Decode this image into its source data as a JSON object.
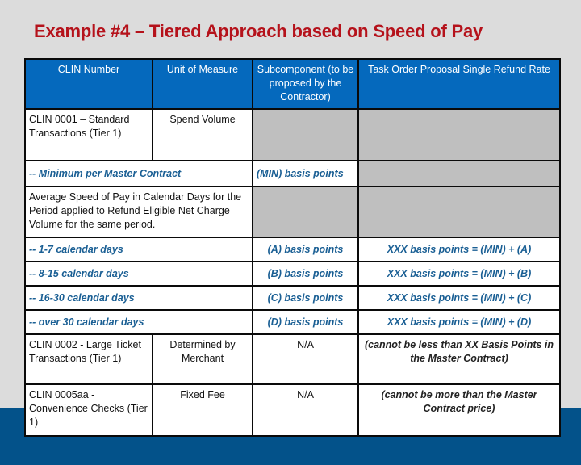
{
  "title": "Example #4 – Tiered Approach based on Speed of Pay",
  "colors": {
    "title": "#b5121b",
    "header_bg": "#0569bd",
    "gray_cell": "#bfbfbf",
    "italic_blue": "#1a5f94",
    "bottom_band": "#03528a",
    "background": "#dcdcdc"
  },
  "table": {
    "headers": [
      "CLIN Number",
      "Unit of Measure",
      "Subcomponent (to be proposed by the Contractor)",
      "Task Order Proposal Single Refund Rate"
    ],
    "clin_0001": {
      "clin": "CLIN 0001 – Standard Transactions (Tier 1)",
      "unit": "Spend Volume"
    },
    "minimum": {
      "label": "-- Minimum per Master Contract",
      "subcomponent": "(MIN) basis points"
    },
    "speed_note": "Average Speed of Pay in Calendar Days for the Period applied to Refund Eligible Net Charge Volume for the same period.",
    "tiers": [
      {
        "label": "-- 1-7 calendar days",
        "subcomponent": "(A) basis points",
        "rate": "XXX basis points  = (MIN) + (A)"
      },
      {
        "label": "-- 8-15 calendar days",
        "subcomponent": "(B) basis points",
        "rate": "XXX basis points = (MIN) + (B)"
      },
      {
        "label": "-- 16-30 calendar days",
        "subcomponent": "(C) basis points",
        "rate": "XXX basis points = (MIN) + (C)"
      },
      {
        "label": "-- over 30 calendar days",
        "subcomponent": "(D) basis points",
        "rate": "XXX basis points = (MIN) + (D)"
      }
    ],
    "clin_0002": {
      "clin": "CLIN 0002 - Large Ticket Transactions (Tier 1)",
      "unit": "Determined by Merchant",
      "subcomponent": "N/A",
      "rate": "(cannot be less than XX Basis Points in the Master Contract)"
    },
    "clin_0005aa": {
      "clin": "CLIN 0005aa - Convenience Checks (Tier 1)",
      "unit": "Fixed Fee",
      "subcomponent": "N/A",
      "rate": "(cannot be more than the Master Contract price)"
    }
  }
}
